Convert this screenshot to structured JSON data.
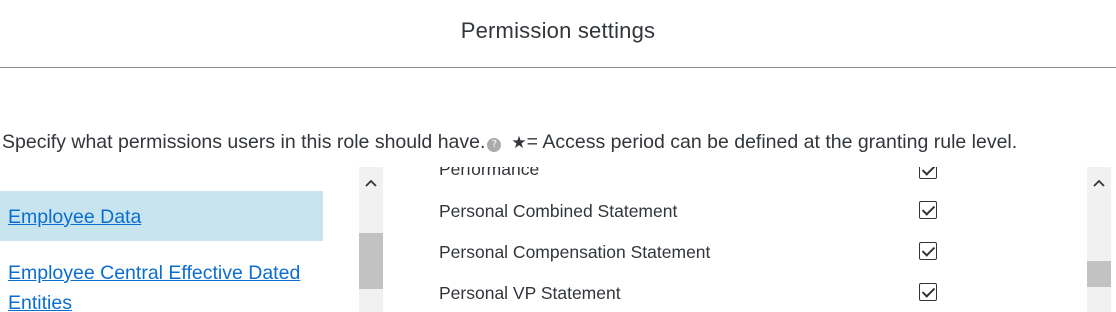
{
  "header": {
    "title": "Permission settings"
  },
  "instruction": {
    "text": "Specify what permissions users in this role should have.",
    "help_icon": "?",
    "star_symbol": "★",
    "star_text": "= Access period can be defined at the granting rule level."
  },
  "left_nav": {
    "items": [
      {
        "label": "Employee Data",
        "selected": true
      },
      {
        "label": "Employee Central Effective Dated",
        "selected": false
      },
      {
        "label": "Entities",
        "selected": false
      }
    ]
  },
  "permissions": [
    {
      "label": "Performance",
      "checked": true
    },
    {
      "label": "Personal Combined Statement",
      "checked": true
    },
    {
      "label": "Personal Compensation Statement",
      "checked": true
    },
    {
      "label": "Personal VP Statement",
      "checked": true
    }
  ],
  "icons": {
    "scroll_up": "chevron-up-icon",
    "help": "help-icon",
    "check": "checkmark-icon"
  },
  "colors": {
    "link": "#0a6ed1",
    "selected_bg": "#c8e4ef",
    "text": "#32363a"
  }
}
